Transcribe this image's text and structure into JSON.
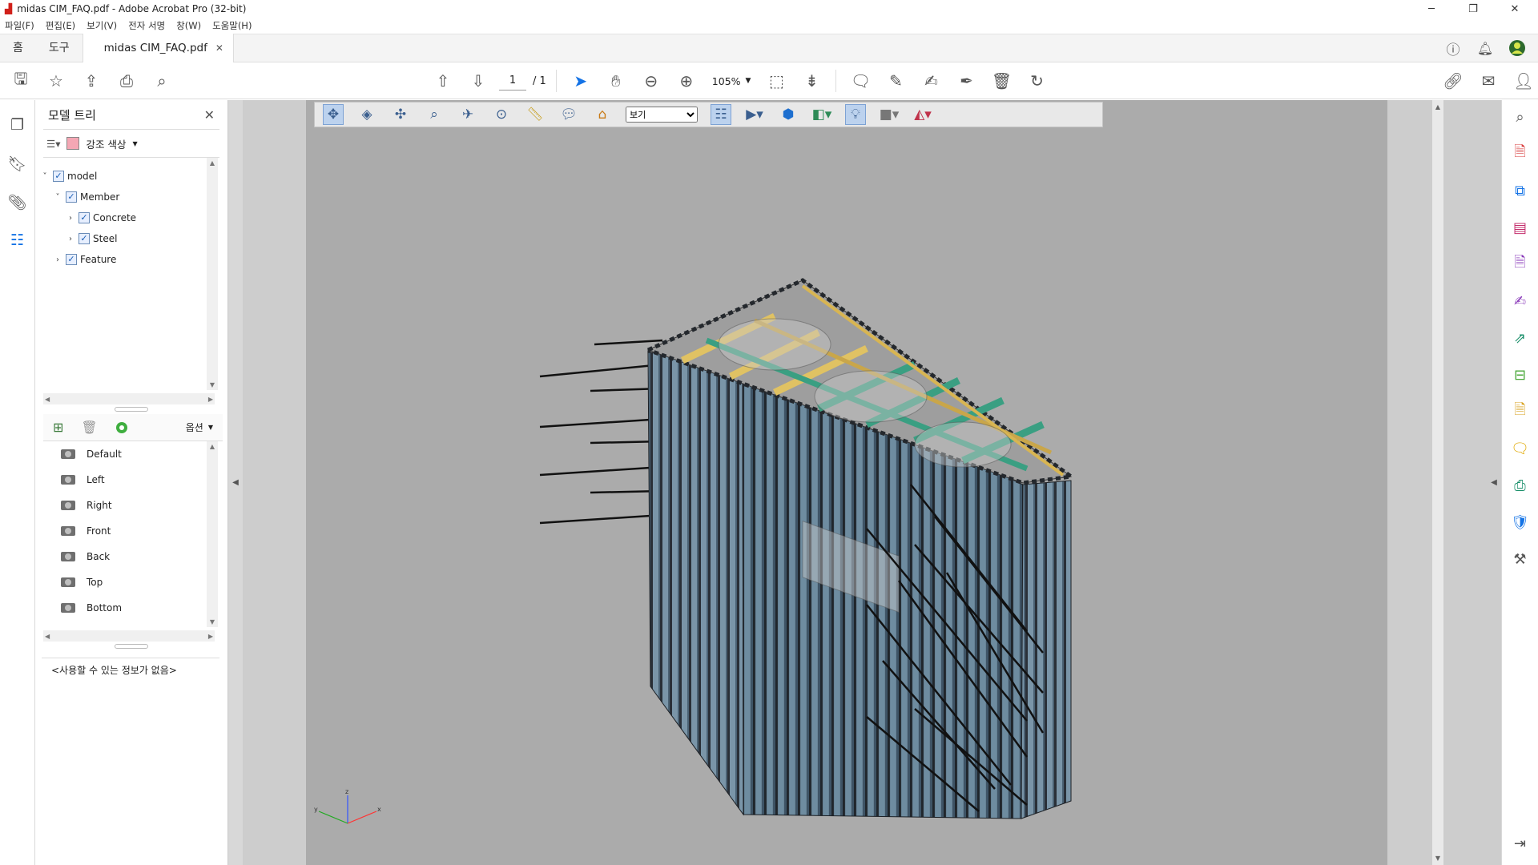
{
  "window": {
    "title": "midas CIM_FAQ.pdf - Adobe Acrobat Pro (32-bit)"
  },
  "menu": [
    "파일(F)",
    "편집(E)",
    "보기(V)",
    "전자 서명",
    "창(W)",
    "도움말(H)"
  ],
  "tabs": {
    "home": "홈",
    "tools": "도구",
    "document": "midas CIM_FAQ.pdf"
  },
  "toolbar": {
    "page_current": "1",
    "page_total": "/ 1",
    "zoom": "105%"
  },
  "model_tree": {
    "title": "모델 트리",
    "highlight_label": "강조 색상",
    "highlight_color": "#f4a7b4",
    "nodes": [
      "model",
      "Member",
      "Concrete",
      "Steel",
      "Feature"
    ],
    "options_label": "옵션",
    "views": [
      "Default",
      "Left",
      "Right",
      "Front",
      "Back",
      "Top",
      "Bottom"
    ],
    "no_info": "<사용할 수 있는 정보가 없음>"
  },
  "toolbar3d": {
    "view_select": "보기"
  },
  "axes": {
    "x": "x",
    "y": "y",
    "z": "z"
  },
  "colors": {
    "accent": "#1473e6",
    "pile": "#5f7d93",
    "beam_green": "#3a9f82",
    "beam_yellow": "#e0c263"
  }
}
